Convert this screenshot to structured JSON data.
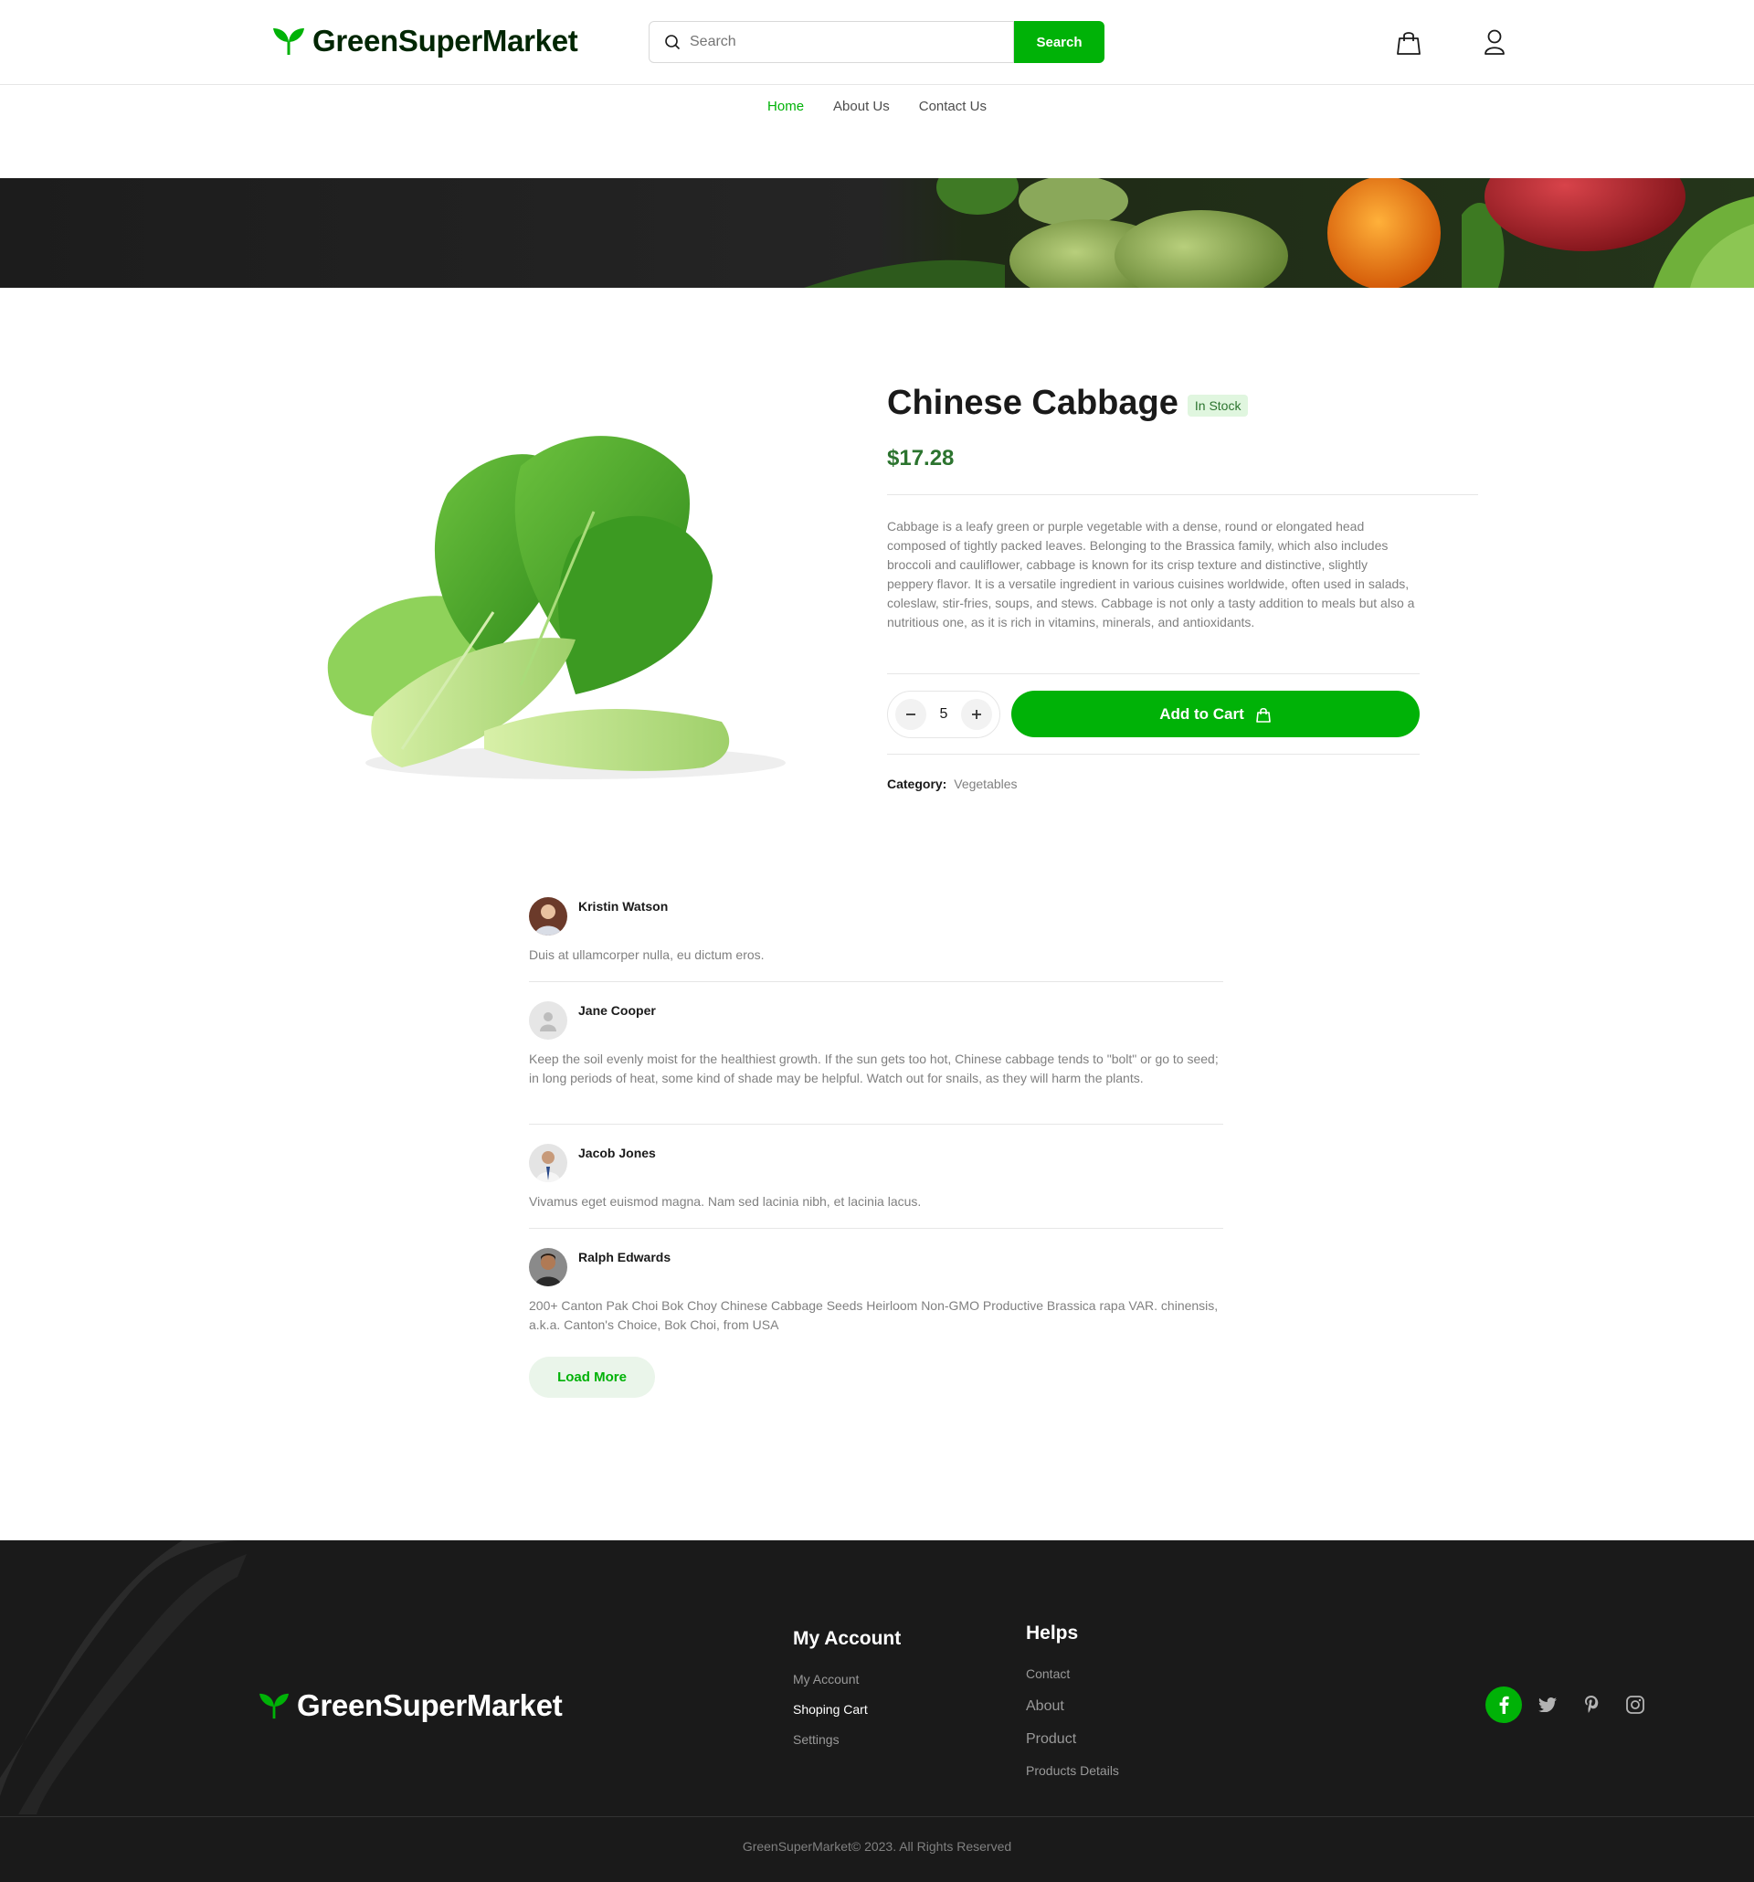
{
  "header": {
    "logo_text": "GreenSuperMarket",
    "search_placeholder": "Search",
    "search_button": "Search"
  },
  "nav": {
    "items": [
      "Home",
      "About Us",
      "Contact Us"
    ],
    "active": "Home"
  },
  "product": {
    "title": "Chinese Cabbage",
    "stock_badge": "In Stock",
    "price": "$17.28",
    "description": "Cabbage is a leafy green or purple vegetable with a dense, round or elongated head composed of tightly packed leaves. Belonging to the Brassica family, which also includes broccoli and cauliflower, cabbage is known for its crisp texture and distinctive, slightly peppery flavor. It is a versatile ingredient in various cuisines worldwide, often used in salads, coleslaw, stir-fries, soups, and stews. Cabbage is not only a tasty addition to meals but also a nutritious one, as it is rich in vitamins, minerals, and antioxidants.",
    "quantity": "5",
    "add_to_cart": "Add to Cart",
    "category_label": "Category:",
    "category_value": "Vegetables"
  },
  "reviews": [
    {
      "name": "Kristin Watson",
      "text": "Duis at ullamcorper nulla, eu dictum eros."
    },
    {
      "name": "Jane Cooper",
      "text": "Keep the soil evenly moist for the healthiest growth. If the sun gets too hot, Chinese cabbage tends to \"bolt\" or go to seed; in long periods of heat, some kind of shade may be helpful. Watch out for snails, as they will harm the plants."
    },
    {
      "name": "Jacob Jones",
      "text": " Vivamus eget euismod magna. Nam sed lacinia nibh, et lacinia lacus."
    },
    {
      "name": "Ralph Edwards",
      "text": "200+ Canton Pak Choi Bok Choy Chinese Cabbage Seeds Heirloom Non-GMO Productive Brassica rapa VAR. chinensis, a.k.a. Canton's Choice, Bok Choi, from USA"
    }
  ],
  "load_more": "Load More",
  "footer": {
    "logo_text": "GreenSuperMarket",
    "my_account_title": "My Account",
    "my_account_links": [
      "My Account",
      "Shoping Cart",
      "Settings"
    ],
    "helps_title": "Helps",
    "helps_links": [
      "Contact",
      "About",
      "Product",
      "Products Details"
    ],
    "social": [
      "facebook-icon",
      "twitter-icon",
      "pinterest-icon",
      "instagram-icon"
    ],
    "copyright": "GreenSuperMarket© 2023. All Rights Reserved"
  },
  "colors": {
    "brand_green": "#00b207",
    "dark_green": "#2c742f",
    "footer_bg": "#1a1a1a"
  }
}
